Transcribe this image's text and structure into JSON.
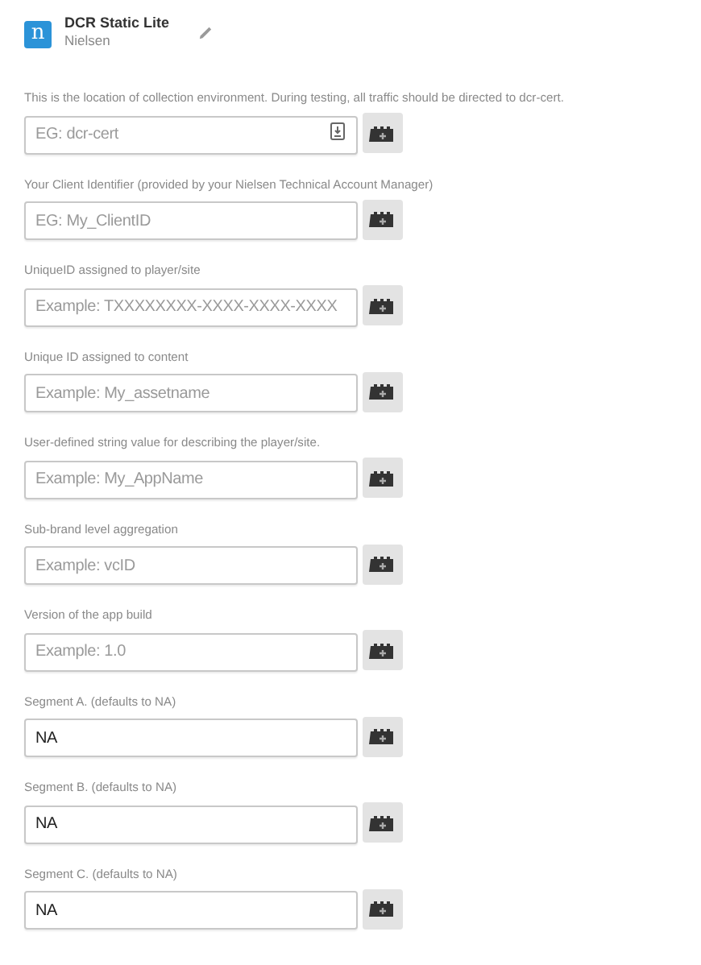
{
  "header": {
    "logo_letter": "n",
    "title": "DCR Static Lite",
    "vendor": "Nielsen"
  },
  "fields": [
    {
      "kind": "picker",
      "label": "This is the location of collection environment. During testing, all traffic should be directed to dcr-cert.",
      "placeholder": "EG: dcr-cert"
    },
    {
      "kind": "plain",
      "label": "Your Client Identifier (provided by your Nielsen Technical Account Manager)",
      "placeholder": "EG: My_ClientID"
    },
    {
      "kind": "plain",
      "label": "UniqueID assigned to player/site",
      "placeholder": "Example: TXXXXXXXX-XXXX-XXXX-XXXX"
    },
    {
      "kind": "plain",
      "label": "Unique ID assigned to content",
      "placeholder": "Example: My_assetname"
    },
    {
      "kind": "plain",
      "label": "User-defined string value for describing the player/site.",
      "placeholder": "Example: My_AppName"
    },
    {
      "kind": "plain",
      "label": "Sub-brand level aggregation",
      "placeholder": "Example: vcID"
    },
    {
      "kind": "plain",
      "label": "Version of the app build",
      "placeholder": "Example: 1.0"
    },
    {
      "kind": "plain",
      "label": "Segment A. (defaults to NA)",
      "value": "NA"
    },
    {
      "kind": "plain",
      "label": "Segment B. (defaults to NA)",
      "value": "NA"
    },
    {
      "kind": "plain",
      "label": "Segment C. (defaults to NA)",
      "value": "NA"
    }
  ]
}
